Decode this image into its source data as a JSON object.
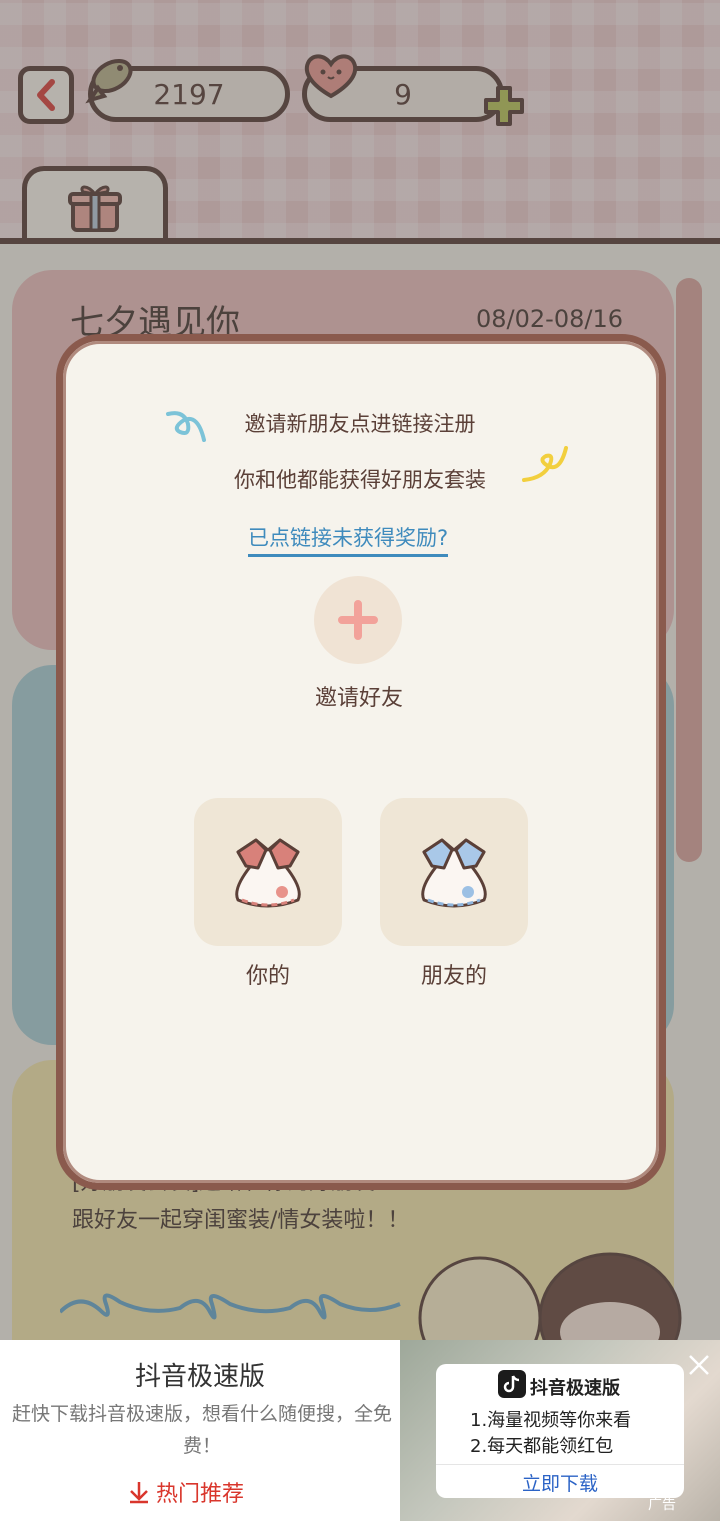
{
  "header": {
    "fish_count": "2197",
    "heart_count": "9"
  },
  "event": {
    "title": "七夕遇见你",
    "date_range": "08/02-08/16",
    "desc_line1": "[好朋友套装]送给和你的好朋友",
    "desc_line2": "跟好友一起穿闺蜜装/情女装啦！！"
  },
  "modal": {
    "line1": "邀请新朋友点进链接注册",
    "line2": "你和他都能获得好朋友套装",
    "help_link": "已点链接未获得奖励?",
    "invite_label": "邀请好友",
    "reward_yours": "你的",
    "reward_friends": "朋友的"
  },
  "ad": {
    "title": "抖音极速版",
    "desc": "赶快下载抖音极速版，想看什么随便搜，全免费！",
    "hot": "热门推荐",
    "app_name": "抖音极速版",
    "feature1": "1.海量视频等你来看",
    "feature2": "2.每天都能领红包",
    "download": "立即下载",
    "tag": "广告"
  },
  "colors": {
    "brown": "#5b4038",
    "modal_border": "#8a5a4d",
    "link": "#3f8bbd",
    "plus": "#f2a29a"
  }
}
